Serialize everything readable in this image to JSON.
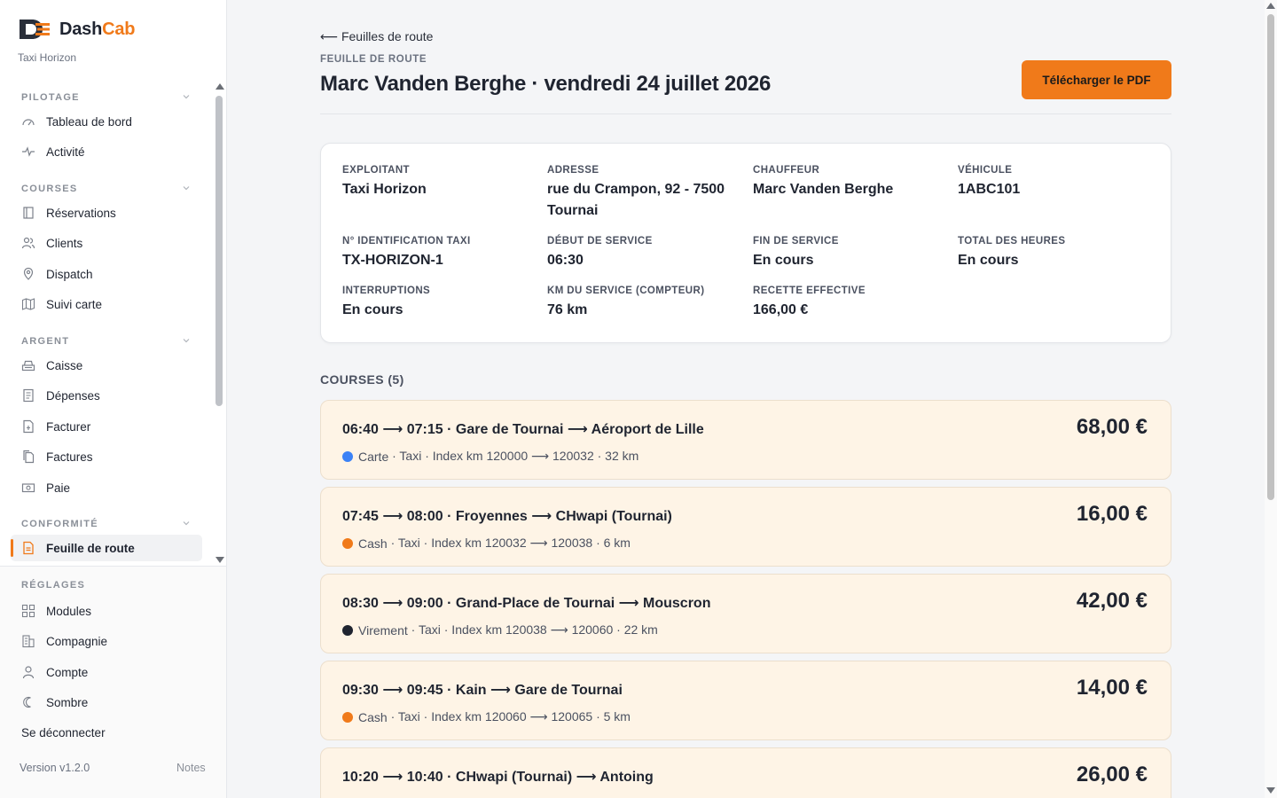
{
  "brand": {
    "name_part1": "Dash",
    "name_part2": "Cab",
    "company": "Taxi Horizon",
    "accent": "#f07a1a"
  },
  "sidebar": {
    "sections": [
      {
        "title": "PILOTAGE",
        "items": [
          {
            "label": "Tableau de bord",
            "icon": "gauge-icon"
          },
          {
            "label": "Activité",
            "icon": "activity-icon"
          }
        ]
      },
      {
        "title": "COURSES",
        "items": [
          {
            "label": "Réservations",
            "icon": "book-icon"
          },
          {
            "label": "Clients",
            "icon": "users-icon"
          },
          {
            "label": "Dispatch",
            "icon": "pin-icon"
          },
          {
            "label": "Suivi carte",
            "icon": "map-icon"
          }
        ]
      },
      {
        "title": "ARGENT",
        "items": [
          {
            "label": "Caisse",
            "icon": "register-icon"
          },
          {
            "label": "Dépenses",
            "icon": "receipt-icon"
          },
          {
            "label": "Facturer",
            "icon": "invoice-add-icon"
          },
          {
            "label": "Factures",
            "icon": "invoices-icon"
          },
          {
            "label": "Paie",
            "icon": "money-icon"
          }
        ]
      },
      {
        "title": "CONFORMITÉ",
        "items": [
          {
            "label": "Feuille de route",
            "icon": "document-icon",
            "active": true
          }
        ]
      }
    ],
    "settings": {
      "title": "RÉGLAGES",
      "items": [
        {
          "label": "Modules",
          "icon": "grid-icon"
        },
        {
          "label": "Compagnie",
          "icon": "building-icon"
        },
        {
          "label": "Compte",
          "icon": "user-icon"
        },
        {
          "label": "Sombre",
          "icon": "moon-icon"
        }
      ]
    },
    "logout": "Se déconnecter",
    "version": "Version v1.2.0",
    "notes": "Notes"
  },
  "header": {
    "back": "⟵ Feuilles de route",
    "eyebrow": "FEUILLE DE ROUTE",
    "title": "Marc Vanden Berghe · vendredi 24 juillet 2026",
    "pdf_button": "Télécharger le PDF"
  },
  "info": {
    "operator_label": "Exploitant",
    "operator": "Taxi Horizon",
    "address_label": "Adresse",
    "address": "rue du Crampon, 92 - 7500 Tournai",
    "driver_label": "Chauffeur",
    "driver": "Marc Vanden Berghe",
    "vehicle_label": "Véhicule",
    "vehicle": "1ABC101",
    "taxi_id_label": "N° identification taxi",
    "taxi_id": "TX-HORIZON-1",
    "start_label": "Début de service",
    "start": "06:30",
    "end_label": "Fin de service",
    "end": "En cours",
    "hours_label": "Total des heures",
    "hours": "En cours",
    "breaks_label": "Interruptions",
    "breaks": "En cours",
    "km_label": "KM du service (compteur)",
    "km": "76 km",
    "revenue_label": "Recette effective",
    "revenue": "166,00 €"
  },
  "courses": {
    "heading": "COURSES (5)",
    "rides": [
      {
        "route": "06:40 ⟶ 07:15 · Gare de Tournai ⟶ Aéroport de Lille",
        "payment": "Carte",
        "payment_color": "#3b82f6",
        "meta": " · Taxi · Index km 120000 ⟶ 120032 · 32 km",
        "amount": "68,00 €"
      },
      {
        "route": "07:45 ⟶ 08:00 · Froyennes ⟶ CHwapi (Tournai)",
        "payment": "Cash",
        "payment_color": "#f07a1a",
        "meta": " · Taxi · Index km 120032 ⟶ 120038 · 6 km",
        "amount": "16,00 €"
      },
      {
        "route": "08:30 ⟶ 09:00 · Grand-Place de Tournai ⟶ Mouscron",
        "payment": "Virement",
        "payment_color": "#1f2430",
        "meta": " · Taxi · Index km 120038 ⟶ 120060 · 22 km",
        "amount": "42,00 €"
      },
      {
        "route": "09:30 ⟶ 09:45 · Kain ⟶ Gare de Tournai",
        "payment": "Cash",
        "payment_color": "#f07a1a",
        "meta": " · Taxi · Index km 120060 ⟶ 120065 · 5 km",
        "amount": "14,00 €"
      },
      {
        "route": "10:20 ⟶ 10:40 · CHwapi (Tournai) ⟶ Antoing",
        "payment": "",
        "payment_color": "",
        "meta": "",
        "amount": "26,00 €"
      }
    ]
  }
}
